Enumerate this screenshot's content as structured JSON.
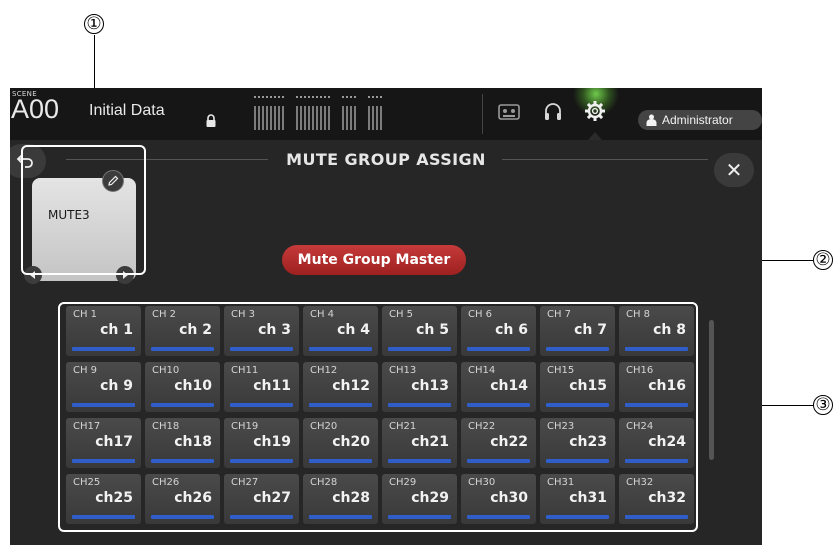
{
  "scene": {
    "label": "SCENE",
    "number": "A00",
    "name": "Initial Data"
  },
  "user": {
    "name": "Administrator"
  },
  "panel": {
    "title": "MUTE GROUP ASSIGN"
  },
  "group": {
    "name": "MUTE3"
  },
  "master": {
    "label": "Mute Group Master",
    "color": "#b52a2a"
  },
  "channel_color": "#2f5ec8",
  "callouts": [
    "①",
    "②",
    "③"
  ],
  "channels": [
    {
      "num": "CH 1",
      "name": "ch 1"
    },
    {
      "num": "CH 2",
      "name": "ch 2"
    },
    {
      "num": "CH 3",
      "name": "ch 3"
    },
    {
      "num": "CH 4",
      "name": "ch 4"
    },
    {
      "num": "CH 5",
      "name": "ch 5"
    },
    {
      "num": "CH 6",
      "name": "ch 6"
    },
    {
      "num": "CH 7",
      "name": "ch 7"
    },
    {
      "num": "CH 8",
      "name": "ch 8"
    },
    {
      "num": "CH 9",
      "name": "ch 9"
    },
    {
      "num": "CH10",
      "name": "ch10"
    },
    {
      "num": "CH11",
      "name": "ch11"
    },
    {
      "num": "CH12",
      "name": "ch12"
    },
    {
      "num": "CH13",
      "name": "ch13"
    },
    {
      "num": "CH14",
      "name": "ch14"
    },
    {
      "num": "CH15",
      "name": "ch15"
    },
    {
      "num": "CH16",
      "name": "ch16"
    },
    {
      "num": "CH17",
      "name": "ch17"
    },
    {
      "num": "CH18",
      "name": "ch18"
    },
    {
      "num": "CH19",
      "name": "ch19"
    },
    {
      "num": "CH20",
      "name": "ch20"
    },
    {
      "num": "CH21",
      "name": "ch21"
    },
    {
      "num": "CH22",
      "name": "ch22"
    },
    {
      "num": "CH23",
      "name": "ch23"
    },
    {
      "num": "CH24",
      "name": "ch24"
    },
    {
      "num": "CH25",
      "name": "ch25"
    },
    {
      "num": "CH26",
      "name": "ch26"
    },
    {
      "num": "CH27",
      "name": "ch27"
    },
    {
      "num": "CH28",
      "name": "ch28"
    },
    {
      "num": "CH29",
      "name": "ch29"
    },
    {
      "num": "CH30",
      "name": "ch30"
    },
    {
      "num": "CH31",
      "name": "ch31"
    },
    {
      "num": "CH32",
      "name": "ch32"
    }
  ]
}
